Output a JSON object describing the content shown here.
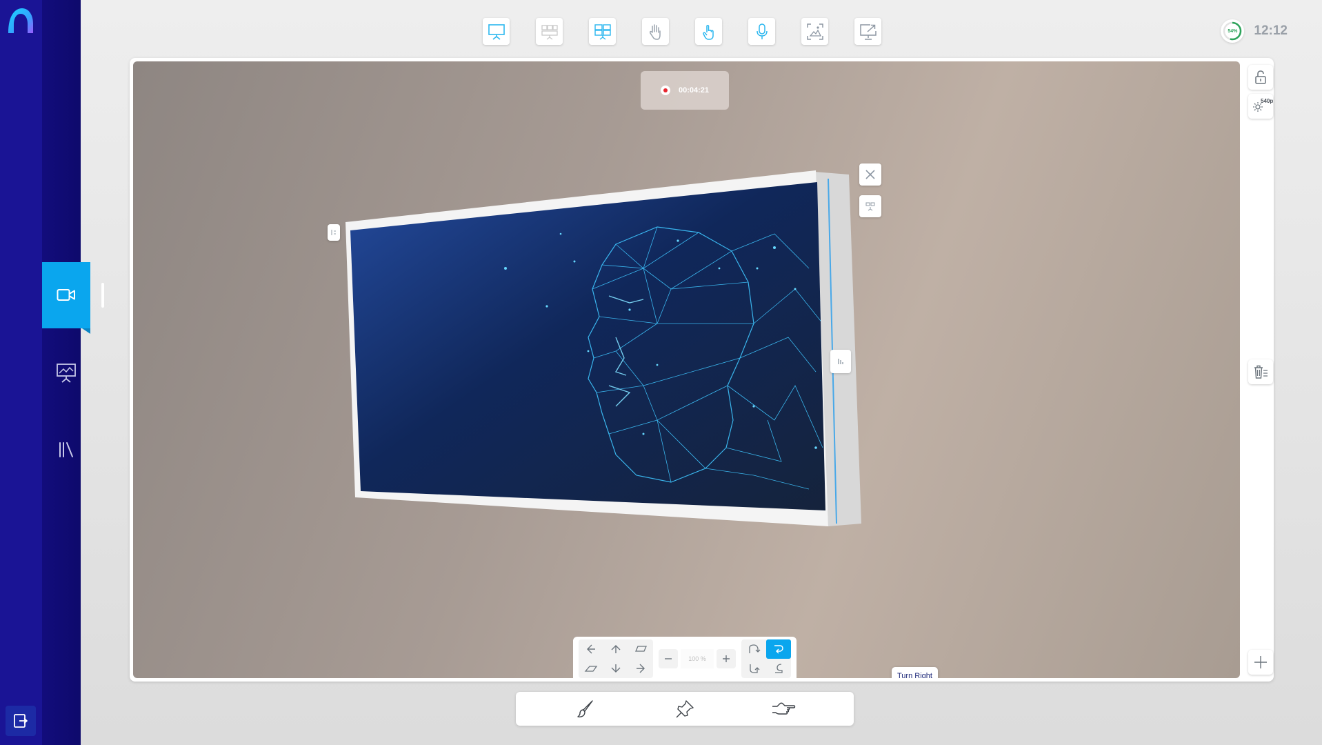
{
  "colors": {
    "sidebar": "#16108e",
    "accent": "#0aa6ee",
    "record": "#e8252e",
    "battery": "#2ca35a"
  },
  "sidebar": {
    "logo": "app-logo",
    "items": [
      {
        "id": "video",
        "icon": "video-camera-icon",
        "active": true
      },
      {
        "id": "presentation",
        "icon": "presentation-board-icon",
        "active": false
      },
      {
        "id": "library",
        "icon": "library-icon",
        "active": false
      }
    ],
    "exit_icon": "exit-icon"
  },
  "top_toolbar": {
    "tools": [
      {
        "id": "whiteboard",
        "icon": "presentation-icon"
      },
      {
        "id": "multi-screen",
        "icon": "multi-screen-icon"
      },
      {
        "id": "split-screen",
        "icon": "split-screen-icon"
      },
      {
        "id": "hand-gesture",
        "icon": "hand-icon"
      },
      {
        "id": "touch",
        "icon": "touch-pointer-icon"
      },
      {
        "id": "microphone",
        "icon": "microphone-icon"
      },
      {
        "id": "capture",
        "icon": "screenshot-icon"
      },
      {
        "id": "share-screen",
        "icon": "share-screen-icon"
      }
    ]
  },
  "status": {
    "battery": "54%",
    "clock": "12:12"
  },
  "recording": {
    "time": "00:04:21"
  },
  "transform_panel": {
    "zoom_value": "100 %",
    "tooltip": "Turn Right",
    "active_button": "turn-right"
  },
  "right_rail": {
    "resolution": "540p"
  }
}
